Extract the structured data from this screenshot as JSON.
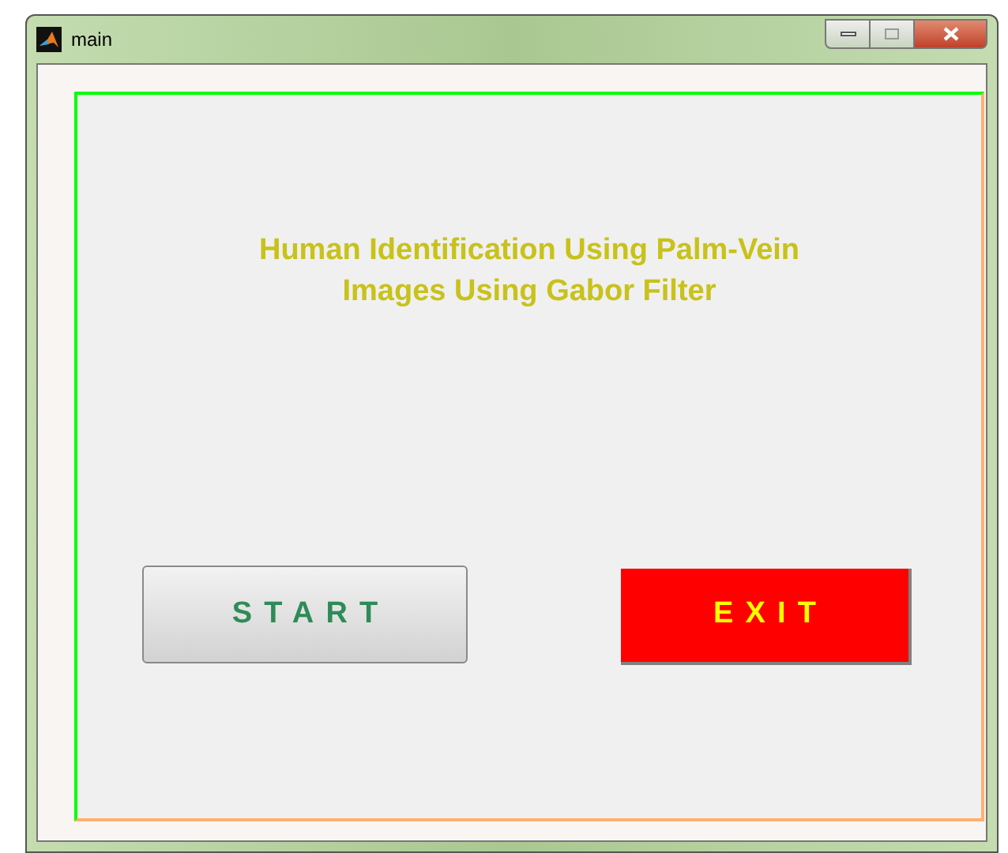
{
  "window": {
    "title": "main"
  },
  "heading": "Human Identification Using Palm-Vein Images Using Gabor Filter",
  "buttons": [
    {
      "label": "START",
      "kind": "default"
    },
    {
      "label": "EXIT",
      "kind": "danger"
    }
  ]
}
